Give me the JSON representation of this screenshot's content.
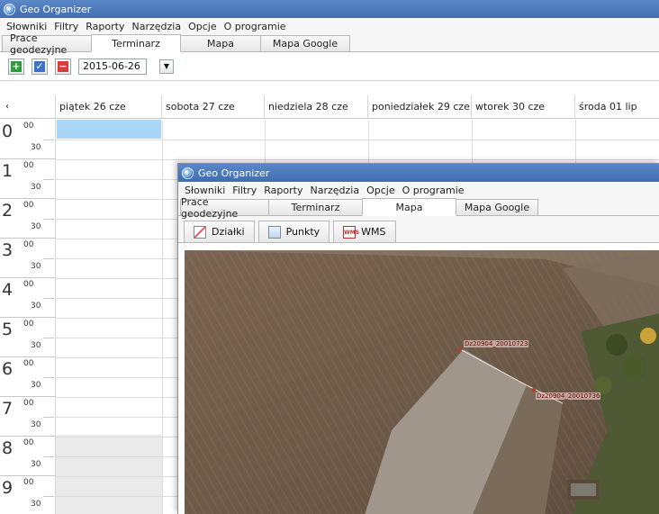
{
  "app": {
    "title": "Geo Organizer"
  },
  "menu": [
    "Słowniki",
    "Filtry",
    "Raporty",
    "Narzędzia",
    "Opcje",
    "O programie"
  ],
  "tabs": [
    {
      "label": "Prace geodezyjne"
    },
    {
      "label": "Terminarz",
      "active": true
    },
    {
      "label": "Mapa"
    },
    {
      "label": "Mapa Google"
    }
  ],
  "toolbar": {
    "date": "2015-06-26"
  },
  "calendar": {
    "corner": "‹",
    "days": [
      "piątek 26 cze",
      "sobota 27 cze",
      "niedziela 28 cze",
      "poniedziałek 29 cze",
      "wtorek 30 cze",
      "środa 01 lip"
    ],
    "hours": [
      {
        "h": "0",
        "m00": "00",
        "m30": "30"
      },
      {
        "h": "1",
        "m00": "00",
        "m30": "30"
      },
      {
        "h": "2",
        "m00": "00",
        "m30": "30"
      },
      {
        "h": "3",
        "m00": "00",
        "m30": "30"
      },
      {
        "h": "4",
        "m00": "00",
        "m30": "30"
      },
      {
        "h": "5",
        "m00": "00",
        "m30": "30"
      },
      {
        "h": "6",
        "m00": "00",
        "m30": "30"
      },
      {
        "h": "7",
        "m00": "00",
        "m30": "30"
      },
      {
        "h": "8",
        "m00": "00",
        "m30": "30"
      },
      {
        "h": "9",
        "m00": "00",
        "m30": "30"
      }
    ]
  },
  "overlay": {
    "title": "Geo Organizer",
    "menu": [
      "Słowniki",
      "Filtry",
      "Raporty",
      "Narzędzia",
      "Opcje",
      "O programie"
    ],
    "tabs": [
      {
        "label": "Prace geodezyjne"
      },
      {
        "label": "Terminarz"
      },
      {
        "label": "Mapa",
        "active": true
      },
      {
        "label": "Mapa Google"
      }
    ],
    "subtabs": [
      "Działki",
      "Punkty",
      "WMS"
    ],
    "wms_icon_text": "WMS",
    "map_labels": [
      "Dz20904_20010723",
      "Dz20904_20010736"
    ]
  },
  "colors": {
    "titlebar": "#4a78bc",
    "selection": "#a9d6f8"
  }
}
